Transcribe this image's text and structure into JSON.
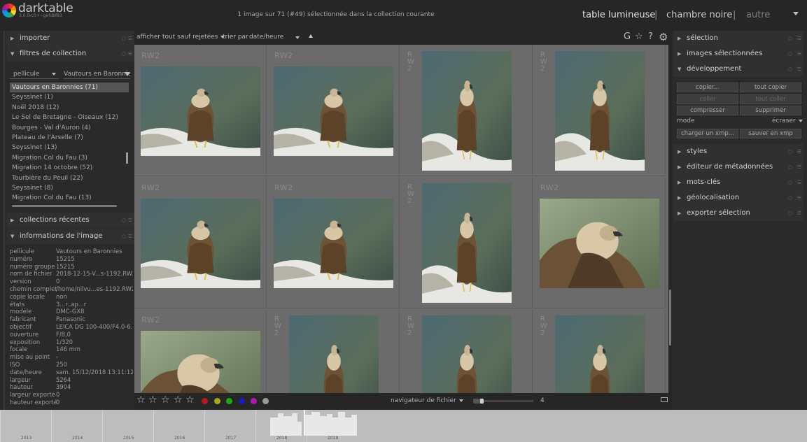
{
  "app": {
    "name": "darktable",
    "version": "3.0.0rc0+~gefdbf83"
  },
  "header": {
    "status": "1 image sur 71 (#49) sélectionnée dans la collection courante",
    "views": [
      "table lumineuse",
      "chambre noire",
      "autre"
    ],
    "separator": "|"
  },
  "left_panel": {
    "modules": {
      "import": "importer",
      "collect": "filtres de collection",
      "recent": "collections récentes",
      "info": "informations de l'image"
    },
    "icons": {
      "reset": "○",
      "presets": "☰",
      "collapsed": "▶",
      "expanded": "▼"
    },
    "collect": {
      "property": "pellicule",
      "value": "Vautours en Baronnies",
      "items": [
        "Vautours en Baronnies (71)",
        "Seyssinet (1)",
        "Noël 2018 (12)",
        "Le Sel de Bretagne - Oiseaux (12)",
        "Bourges - Val d'Auron (4)",
        "Plateau de l'Arselle (7)",
        "Seyssinet (13)",
        "Migration Col du Fau (3)",
        "Migration 14 octobre (52)",
        "Tourbière du Peuil (22)",
        "Seyssinet (8)",
        "Migration Col du Fau (13)"
      ],
      "selected_index": 0
    },
    "image_info": [
      {
        "key": "pellicule",
        "value": "Vautours en Baronnies"
      },
      {
        "key": "numéro",
        "value": "15215"
      },
      {
        "key": "numéro groupe",
        "value": "15215"
      },
      {
        "key": "nom de fichier",
        "value": "2018-12-15-V...s-1192.RW2"
      },
      {
        "key": "version",
        "value": "0"
      },
      {
        "key": "chemin complet",
        "value": "/home/nilvu...es-1192.RW2"
      },
      {
        "key": "copie locale",
        "value": "non"
      },
      {
        "key": "états",
        "value": "3...r..ap...r"
      },
      {
        "key": "modèle",
        "value": "DMC-GX8"
      },
      {
        "key": "fabricant",
        "value": "Panasonic"
      },
      {
        "key": "objectif",
        "value": "LEICA DG 100-400/F4.0-6..."
      },
      {
        "key": "ouverture",
        "value": "F/8,0"
      },
      {
        "key": "exposition",
        "value": "1/320"
      },
      {
        "key": "focale",
        "value": "146 mm"
      },
      {
        "key": "mise au point",
        "value": "-"
      },
      {
        "key": "ISO",
        "value": "250"
      },
      {
        "key": "date/heure",
        "value": "sam. 15/12/2018 13:11:12"
      },
      {
        "key": "largeur",
        "value": "5264"
      },
      {
        "key": "hauteur",
        "value": "3904"
      },
      {
        "key": "largeur exporté",
        "value": "0"
      },
      {
        "key": "hauteur exporté",
        "value": "0"
      }
    ]
  },
  "toolbar": {
    "show_label": "afficher",
    "show_value": "tout sauf rejetées",
    "sort_label": "trier par",
    "sort_value": "date/heure",
    "sort_dir_icon": "triangle-up",
    "grouping": "G",
    "overlay_icon": "☆",
    "help_icon": "?",
    "prefs_icon": "⚙"
  },
  "grid": {
    "extension": "RW2",
    "thumbnails": [
      {
        "orient": "landscape",
        "ext": "RW2"
      },
      {
        "orient": "landscape",
        "ext": "RW2"
      },
      {
        "orient": "portrait",
        "ext": "RW2"
      },
      {
        "orient": "portrait",
        "ext": "RW2"
      },
      {
        "orient": "landscape",
        "ext": "RW2"
      },
      {
        "orient": "landscape",
        "ext": "RW2"
      },
      {
        "orient": "portrait",
        "ext": "RW2"
      },
      {
        "orient": "landscape-close",
        "ext": "RW2"
      },
      {
        "orient": "landscape-close",
        "ext": "RW2"
      },
      {
        "orient": "portrait",
        "ext": "RW2"
      },
      {
        "orient": "portrait",
        "ext": "RW2"
      },
      {
        "orient": "portrait",
        "ext": "RW2"
      }
    ]
  },
  "bottom_bar": {
    "stars": [
      "☆",
      "☆",
      "☆",
      "☆",
      "☆"
    ],
    "color_labels": [
      "#b01c1c",
      "#a8a81c",
      "#1ca81c",
      "#1c1cb0",
      "#a81ca8",
      "#9a9a9a"
    ],
    "navigator": "navigateur de fichier",
    "zoom": "4"
  },
  "right_panel": {
    "modules": {
      "select": "sélection",
      "selected": "images sélectionnées",
      "history": "développement",
      "styles": "styles",
      "metadata": "éditeur de métadonnées",
      "tags": "mots-clés",
      "geo": "géolocalisation",
      "export": "exporter sélection"
    },
    "history_buttons": {
      "copy": "copier...",
      "copy_all": "tout copier",
      "paste": "coller",
      "paste_all": "tout coller",
      "compress": "compresser",
      "discard": "supprimer",
      "load_xmp": "charger un xmp...",
      "write_xmp": "sauver en xmp"
    },
    "mode_label": "mode",
    "mode_value": "écraser"
  },
  "timeline": {
    "years": [
      "2013",
      "2014",
      "2015",
      "2016",
      "2017",
      "2018",
      "2019"
    ]
  }
}
